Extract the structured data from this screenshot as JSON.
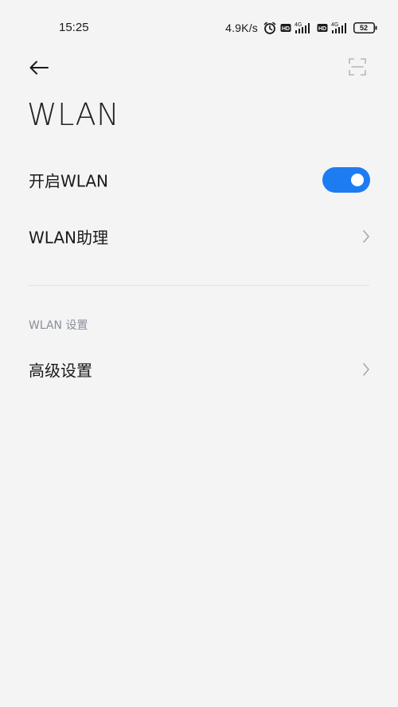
{
  "status_bar": {
    "time": "15:25",
    "net_speed": "4.9K/s",
    "network_type_1": "4G",
    "network_type_2": "4G",
    "hd_label": "HD",
    "battery_level": "52"
  },
  "page": {
    "title": "WLAN"
  },
  "rows": {
    "enable_wlan": {
      "label": "开启WLAN",
      "toggle_on": true
    },
    "wlan_assistant": {
      "label": "WLAN助理"
    },
    "advanced": {
      "label": "高级设置"
    }
  },
  "section": {
    "header": "WLAN 设置"
  },
  "colors": {
    "accent": "#1d7cf2",
    "background": "#f4f4f4",
    "section_header": "#8a8f99"
  },
  "icons": {
    "back": "arrow-left-icon",
    "scan": "scan-frame-icon",
    "chevron": "chevron-right-icon",
    "alarm": "alarm-clock-icon",
    "signal": "signal-bars-icon",
    "battery": "battery-icon"
  }
}
